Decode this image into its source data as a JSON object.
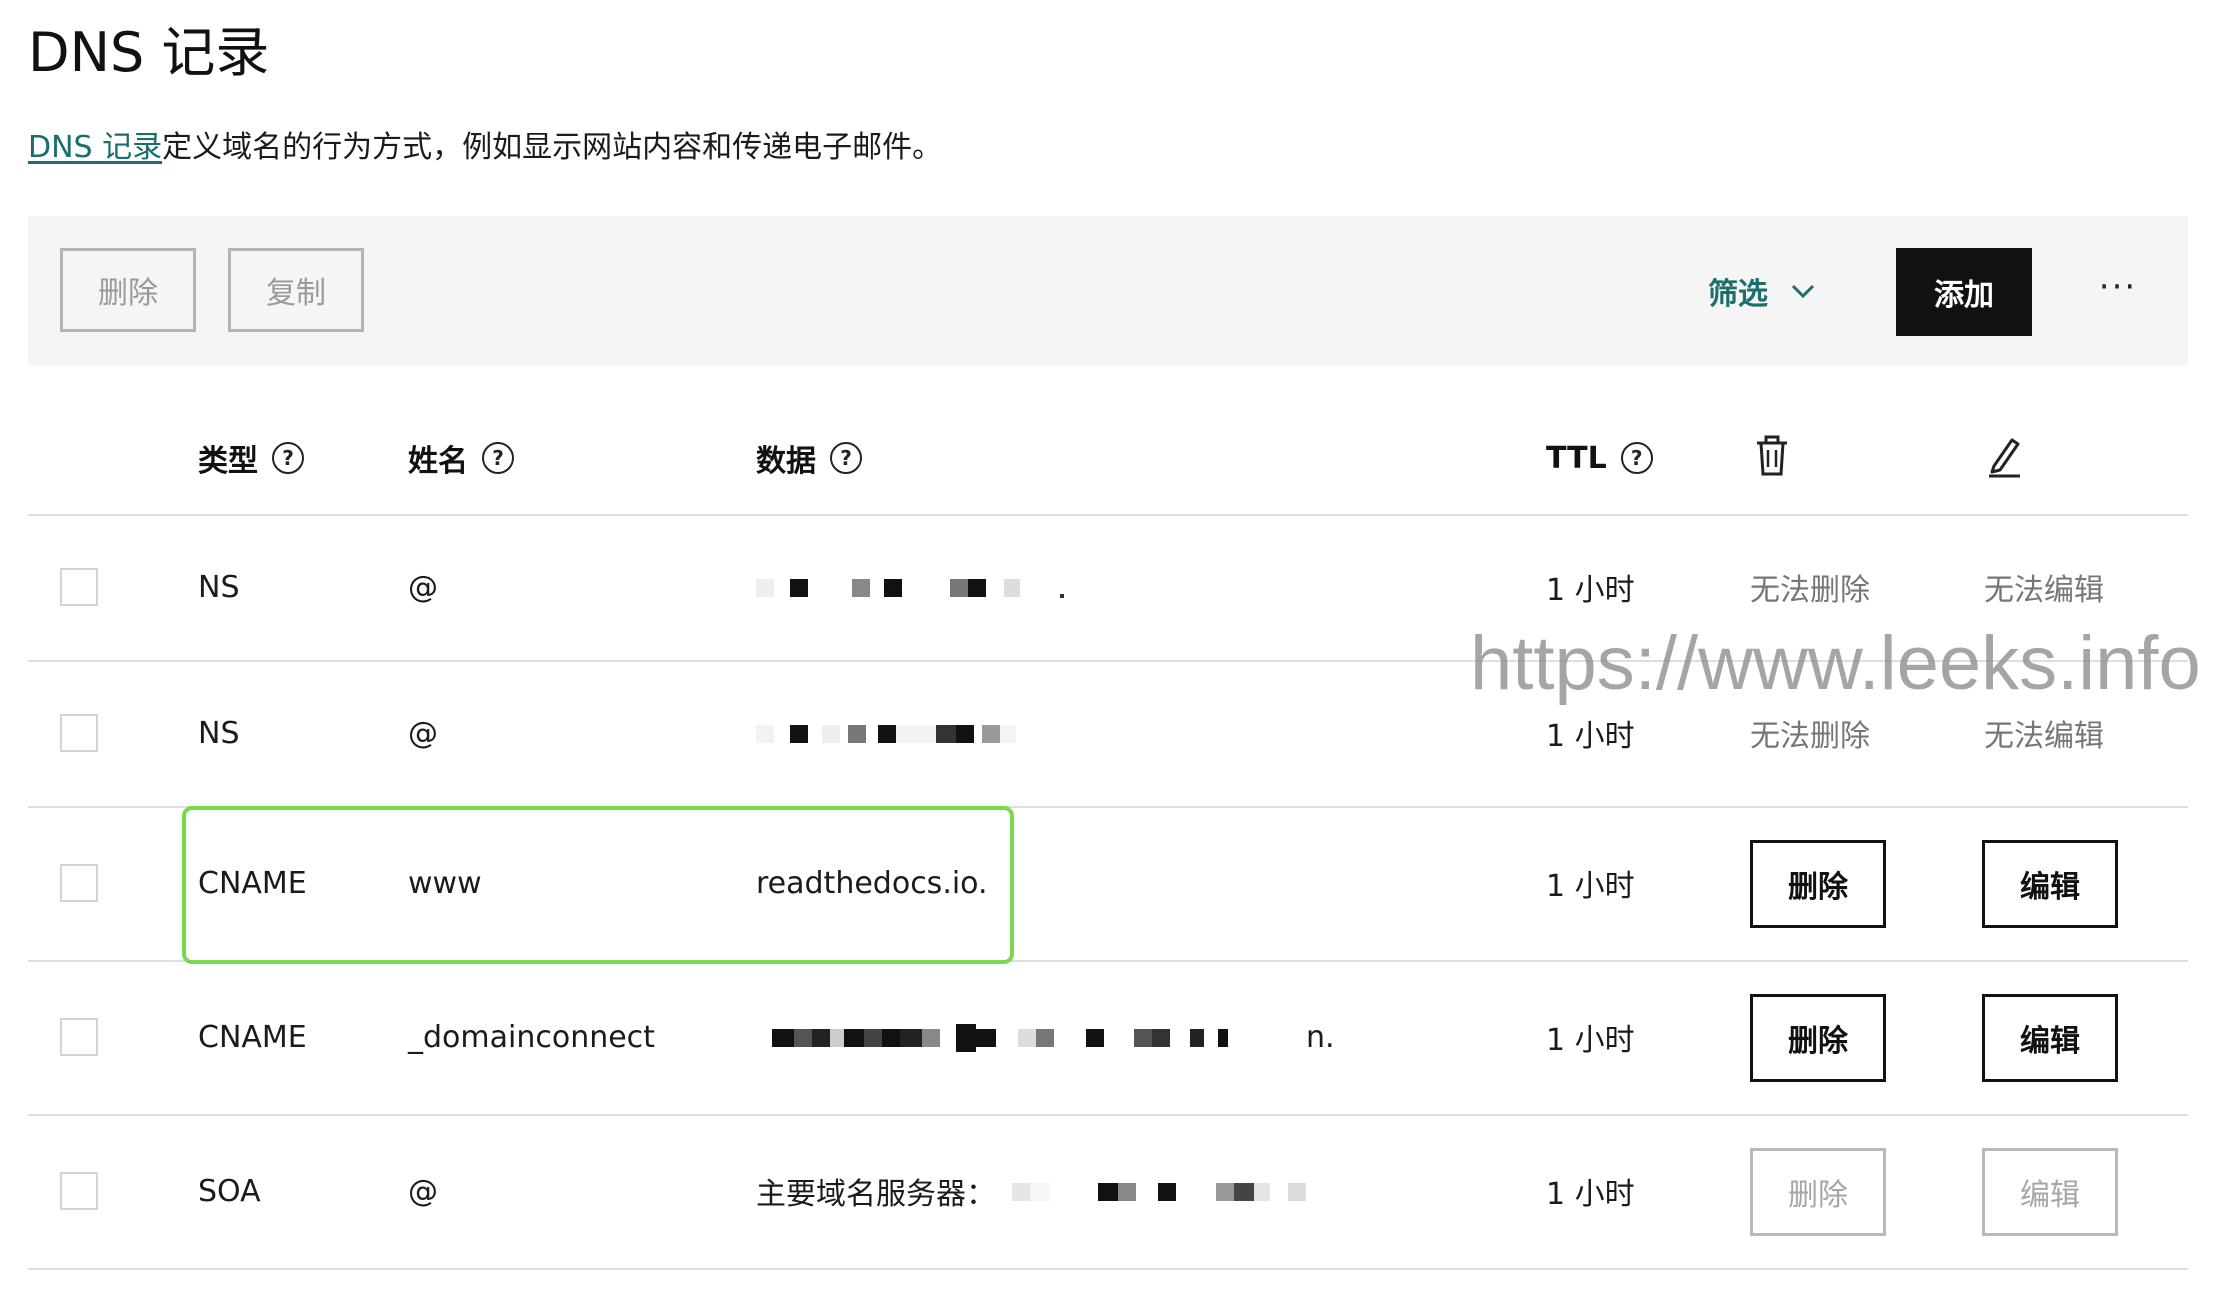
{
  "page": {
    "title": "DNS 记录",
    "description_link": "DNS 记录",
    "description_rest": "定义域名的行为方式，例如显示网站内容和传递电子邮件。"
  },
  "toolbar": {
    "delete_label": "删除",
    "copy_label": "复制",
    "filter_label": "筛选",
    "add_label": "添加",
    "more_label": "···"
  },
  "table": {
    "headers": {
      "type": "类型",
      "name": "姓名",
      "data": "数据",
      "ttl": "TTL"
    },
    "rows": [
      {
        "type": "NS",
        "name": "@",
        "data": "",
        "ttl": "1 小时",
        "delete": "无法删除",
        "edit": "无法编辑"
      },
      {
        "type": "NS",
        "name": "@",
        "data": "",
        "ttl": "1 小时",
        "delete": "无法删除",
        "edit": "无法编辑"
      },
      {
        "type": "CNAME",
        "name": "www",
        "data": "readthedocs.io.",
        "ttl": "1 小时",
        "delete": "删除",
        "edit": "编辑"
      },
      {
        "type": "CNAME",
        "name": "_domainconnect",
        "data": "n.",
        "ttl": "1 小时",
        "delete": "删除",
        "edit": "编辑"
      },
      {
        "type": "SOA",
        "name": "@",
        "data": "主要域名服务器：",
        "ttl": "1 小时",
        "delete": "删除",
        "edit": "编辑"
      }
    ]
  },
  "watermark": "https://www.leeks.info",
  "colors": {
    "accent": "#1a6e6e",
    "highlight": "#7bd84c",
    "primary_button": "#111111",
    "toolbar_bg": "#f5f5f5"
  },
  "icons": {
    "help": "question-circle-icon",
    "delete": "trash-icon",
    "edit": "pencil-icon",
    "filter": "chevron-down-icon"
  }
}
